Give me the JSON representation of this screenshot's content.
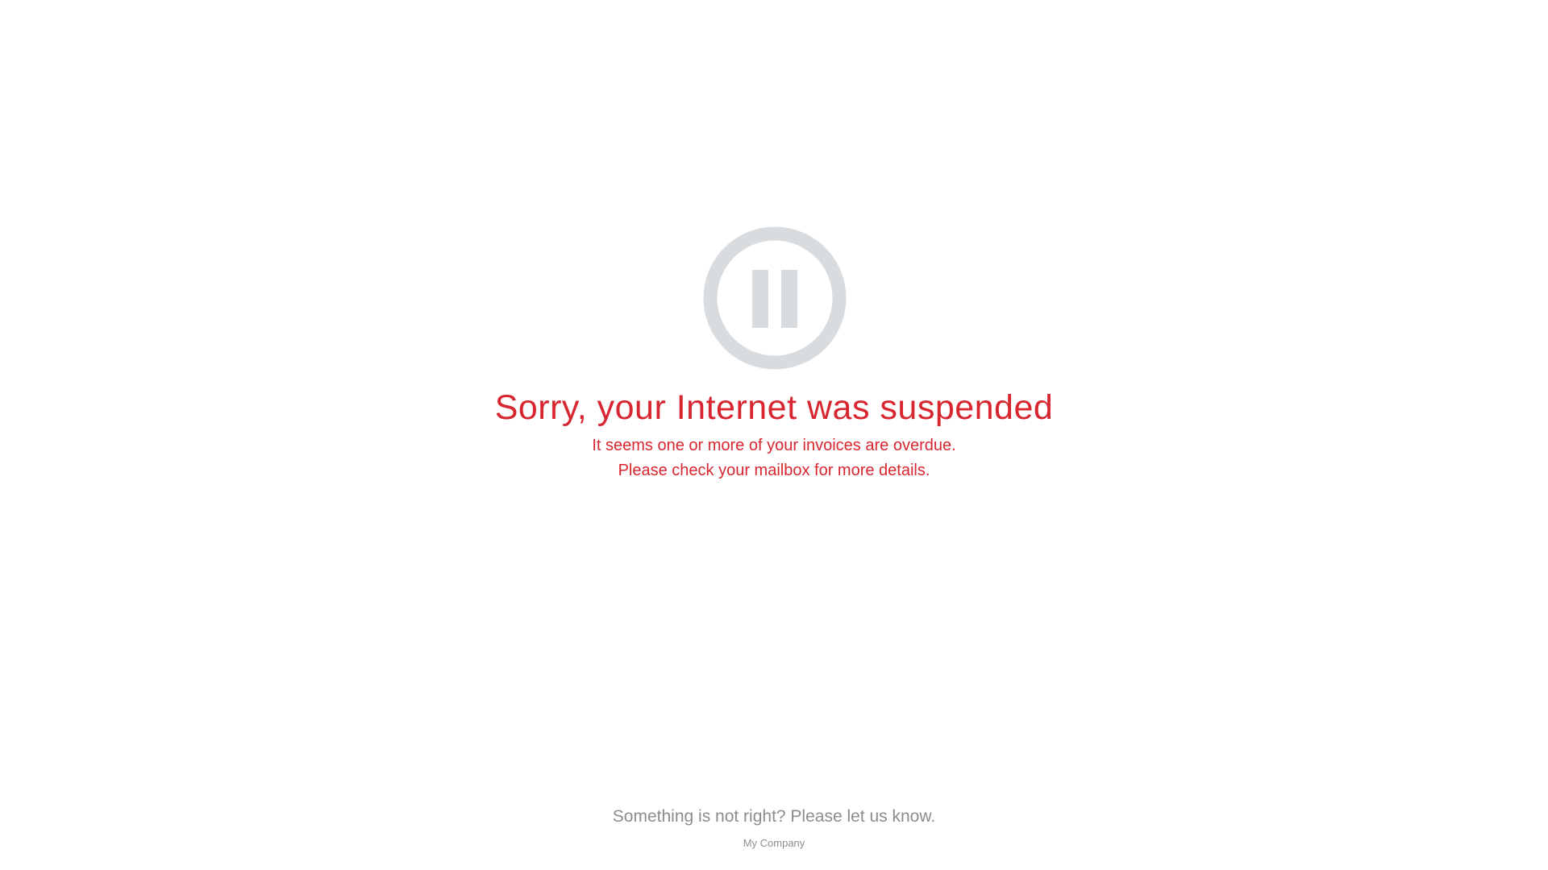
{
  "status": {
    "icon": "pause-circle-icon",
    "icon_color": "#d9dcdf",
    "title": "Sorry, your Internet was suspended",
    "message_lines": [
      "It seems one or more of your invoices are overdue.",
      "Please check your mailbox for more details."
    ],
    "accent_color": "#d7262f"
  },
  "footer": {
    "contact_text": "Something is not right? Please let us know.",
    "company": "My Company",
    "text_color": "#8a8d90"
  }
}
